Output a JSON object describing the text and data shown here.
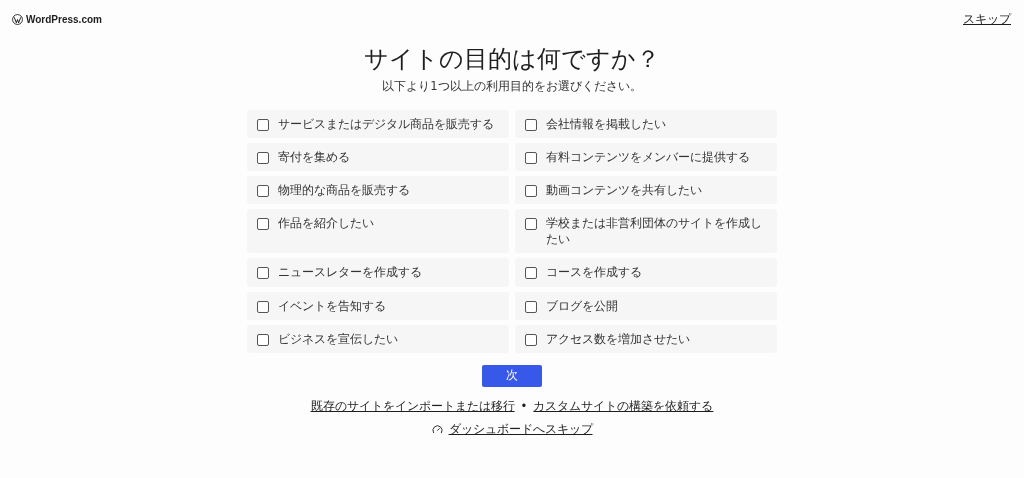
{
  "header": {
    "logo_text": "WordPress.com",
    "skip_link": "スキップ"
  },
  "title": "サイトの目的は何ですか？",
  "subtitle": "以下より1つ以上の利用目的をお選びください。",
  "options": [
    {
      "label": "サービスまたはデジタル商品を販売する",
      "checked": false
    },
    {
      "label": "会社情報を掲載したい",
      "checked": false
    },
    {
      "label": "寄付を集める",
      "checked": false
    },
    {
      "label": "有料コンテンツをメンバーに提供する",
      "checked": false
    },
    {
      "label": "物理的な商品を販売する",
      "checked": false
    },
    {
      "label": "動画コンテンツを共有したい",
      "checked": false
    },
    {
      "label": "作品を紹介したい",
      "checked": false
    },
    {
      "label": "学校または非営利団体のサイトを作成したい",
      "checked": false
    },
    {
      "label": "ニュースレターを作成する",
      "checked": false
    },
    {
      "label": "コースを作成する",
      "checked": false
    },
    {
      "label": "イベントを告知する",
      "checked": false
    },
    {
      "label": "ブログを公開",
      "checked": false
    },
    {
      "label": "ビジネスを宣伝したい",
      "checked": false
    },
    {
      "label": "アクセス数を増加させたい",
      "checked": false
    }
  ],
  "next_button": "次",
  "footer_links": {
    "import": "既存のサイトをインポートまたは移行",
    "separator": "•",
    "custom": "カスタムサイトの構築を依頼する"
  },
  "dashboard_link": "ダッシュボードへスキップ"
}
